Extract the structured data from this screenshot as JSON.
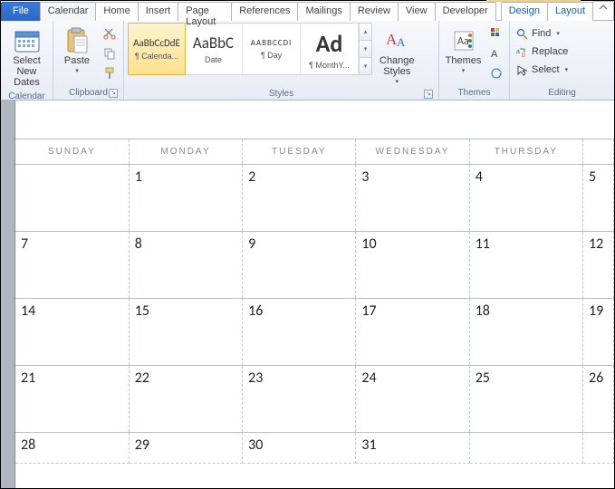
{
  "tabs": {
    "file": "File",
    "list": [
      "Calendar",
      "Home",
      "Insert",
      "Page Layout",
      "References",
      "Mailings",
      "Review",
      "View",
      "Developer"
    ],
    "context": [
      "Design",
      "Layout"
    ],
    "active": "Calendar"
  },
  "ribbon": {
    "calendar": {
      "select_new_dates": "Select\nNew Dates",
      "group": "Calendar"
    },
    "clipboard": {
      "paste": "Paste",
      "group": "Clipboard"
    },
    "styles": {
      "group": "Styles",
      "items": [
        {
          "preview": "AaBbCcDdE",
          "caption": "¶ Calenda...",
          "size": 11
        },
        {
          "preview": "AaBbC",
          "caption": "Date",
          "size": 17
        },
        {
          "preview": "AABBCCDI",
          "caption": "¶ Day",
          "size": 9
        },
        {
          "preview": "Ad",
          "caption": "¶ MonthY...",
          "size": 26
        }
      ],
      "change_styles": "Change\nStyles"
    },
    "themes": {
      "themes": "Themes",
      "group": "Themes"
    },
    "editing": {
      "find": "Find",
      "replace": "Replace",
      "select": "Select",
      "group": "Editing"
    }
  },
  "calendar": {
    "headers": [
      "SUNDAY",
      "MONDAY",
      "TUESDAY",
      "WEDNESDAY",
      "THURSDAY",
      ""
    ],
    "weeks": [
      [
        "",
        "1",
        "2",
        "3",
        "4",
        "5"
      ],
      [
        "7",
        "8",
        "9",
        "10",
        "11",
        "12"
      ],
      [
        "14",
        "15",
        "16",
        "17",
        "18",
        "19"
      ],
      [
        "21",
        "22",
        "23",
        "24",
        "25",
        "26"
      ],
      [
        "28",
        "29",
        "30",
        "31",
        "",
        ""
      ]
    ]
  }
}
